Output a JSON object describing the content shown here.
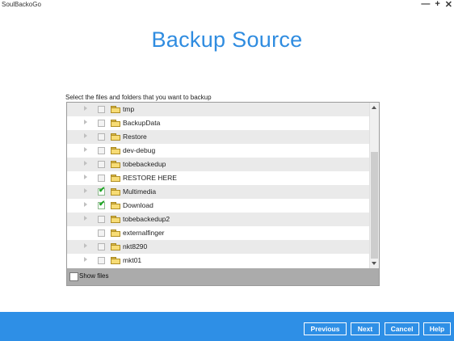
{
  "window": {
    "title": "SoulBackoGo",
    "controls": {
      "minimize": "—",
      "maximize": "+",
      "close": "✕"
    }
  },
  "page": {
    "title": "Backup Source",
    "instruction": "Select the files and folders that you want to backup"
  },
  "tree": {
    "items": [
      {
        "name": "tmp",
        "checked": false,
        "expandable": true
      },
      {
        "name": "BackupData",
        "checked": false,
        "expandable": true
      },
      {
        "name": "Restore",
        "checked": false,
        "expandable": true
      },
      {
        "name": "dev-debug",
        "checked": false,
        "expandable": true
      },
      {
        "name": "tobebackedup",
        "checked": false,
        "expandable": true
      },
      {
        "name": "RESTORE HERE",
        "checked": false,
        "expandable": true
      },
      {
        "name": "Multimedia",
        "checked": true,
        "expandable": true
      },
      {
        "name": "Download",
        "checked": true,
        "expandable": true
      },
      {
        "name": "tobebackedup2",
        "checked": false,
        "expandable": true
      },
      {
        "name": "externalfinger",
        "checked": false,
        "expandable": false
      },
      {
        "name": "nkt8290",
        "checked": false,
        "expandable": true
      },
      {
        "name": "mkt01",
        "checked": false,
        "expandable": true
      }
    ],
    "show_files_label": "Show files",
    "show_files_checked": false
  },
  "buttons": {
    "previous": "Previous",
    "next": "Next",
    "cancel": "Cancel",
    "help": "Help"
  },
  "colors": {
    "accent": "#2e8fe6",
    "title": "#2f8ce0",
    "check": "#1aa520",
    "folder": "#f7dc75"
  }
}
